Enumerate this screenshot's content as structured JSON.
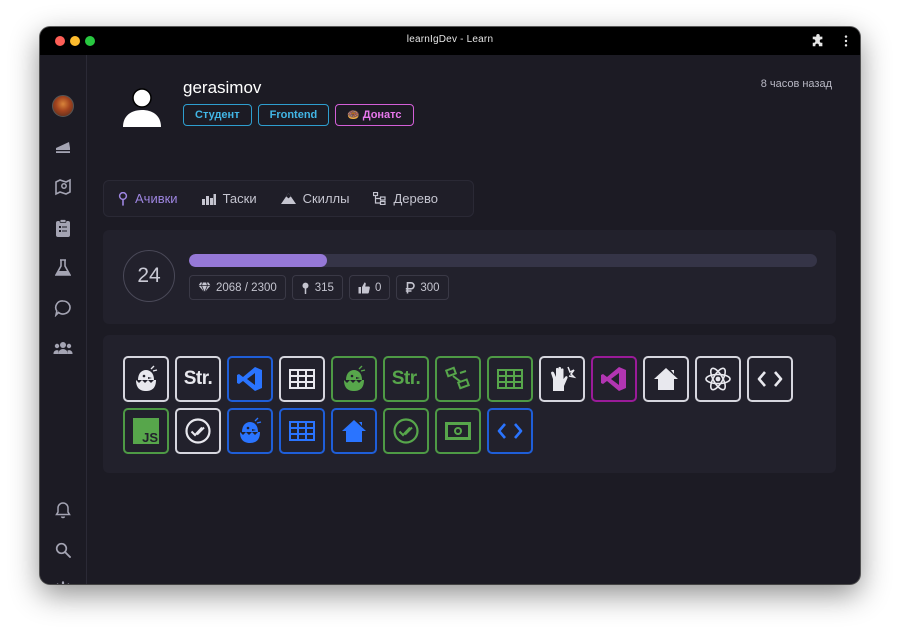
{
  "window": {
    "title": "learnIgDev - Learn"
  },
  "sidebar": {
    "items": [
      {
        "name": "avatar",
        "icon": "user-avatar"
      },
      {
        "name": "cake",
        "icon": "cake-icon"
      },
      {
        "name": "map",
        "icon": "map-icon"
      },
      {
        "name": "tasks",
        "icon": "clipboard-icon"
      },
      {
        "name": "lab",
        "icon": "flask-icon"
      },
      {
        "name": "chat",
        "icon": "chat-icon"
      },
      {
        "name": "users",
        "icon": "users-icon"
      }
    ],
    "bottom": [
      {
        "name": "notifications",
        "icon": "bell-icon"
      },
      {
        "name": "search",
        "icon": "search-icon"
      },
      {
        "name": "settings",
        "icon": "gear-icon"
      }
    ]
  },
  "profile": {
    "username": "gerasimov",
    "time_ago": "8 часов назад",
    "badges": [
      {
        "label": "Студент"
      },
      {
        "label": "Frontend"
      },
      {
        "label": "Донатс",
        "emoji": "🍩"
      }
    ]
  },
  "tabs": [
    {
      "label": "Ачивки",
      "icon": "pin-icon",
      "active": true
    },
    {
      "label": "Таски",
      "icon": "bars-icon",
      "active": false
    },
    {
      "label": "Скиллы",
      "icon": "mountain-icon",
      "active": false
    },
    {
      "label": "Дерево",
      "icon": "tree-icon",
      "active": false
    }
  ],
  "level": {
    "value": "24",
    "progress": 0.22,
    "stats": [
      {
        "icon": "gem-icon",
        "value": "2068 / 2300"
      },
      {
        "icon": "pin-icon",
        "value": "315"
      },
      {
        "icon": "thumbs-up-icon",
        "value": "0"
      },
      {
        "icon": "ruble-icon",
        "value": "300"
      }
    ]
  },
  "achievements": {
    "items": [
      {
        "icon": "chick-icon",
        "color": "white"
      },
      {
        "icon": "str-icon",
        "color": "white",
        "text": "Str."
      },
      {
        "icon": "vscode-icon",
        "color": "blue"
      },
      {
        "icon": "table-icon",
        "color": "white"
      },
      {
        "icon": "chick-icon",
        "color": "green"
      },
      {
        "icon": "str-icon",
        "color": "green",
        "text": "Str."
      },
      {
        "icon": "flow-icon",
        "color": "green"
      },
      {
        "icon": "table-icon",
        "color": "green"
      },
      {
        "icon": "magic-hand-icon",
        "color": "white"
      },
      {
        "icon": "vscode-icon",
        "color": "purple"
      },
      {
        "icon": "house-icon",
        "color": "white"
      },
      {
        "icon": "react-icon",
        "color": "white"
      },
      {
        "icon": "code-icon",
        "color": "white"
      },
      {
        "icon": "js-icon",
        "color": "green",
        "text": "JS"
      },
      {
        "icon": "check-circle-icon",
        "color": "white"
      },
      {
        "icon": "chick-icon",
        "color": "blue"
      },
      {
        "icon": "table-icon",
        "color": "blue"
      },
      {
        "icon": "house-icon",
        "color": "blue"
      },
      {
        "icon": "check-circle-icon",
        "color": "green"
      },
      {
        "icon": "money-icon",
        "color": "green"
      },
      {
        "icon": "code-icon",
        "color": "blue"
      }
    ]
  },
  "colors": {
    "accent": "#9578d7",
    "badge_blue": "#42b6e6",
    "badge_pink": "#e777ec",
    "green": "#57a64b",
    "blue": "#2a74ff",
    "purple": "#b235b2",
    "white": "#e8e8ee"
  }
}
